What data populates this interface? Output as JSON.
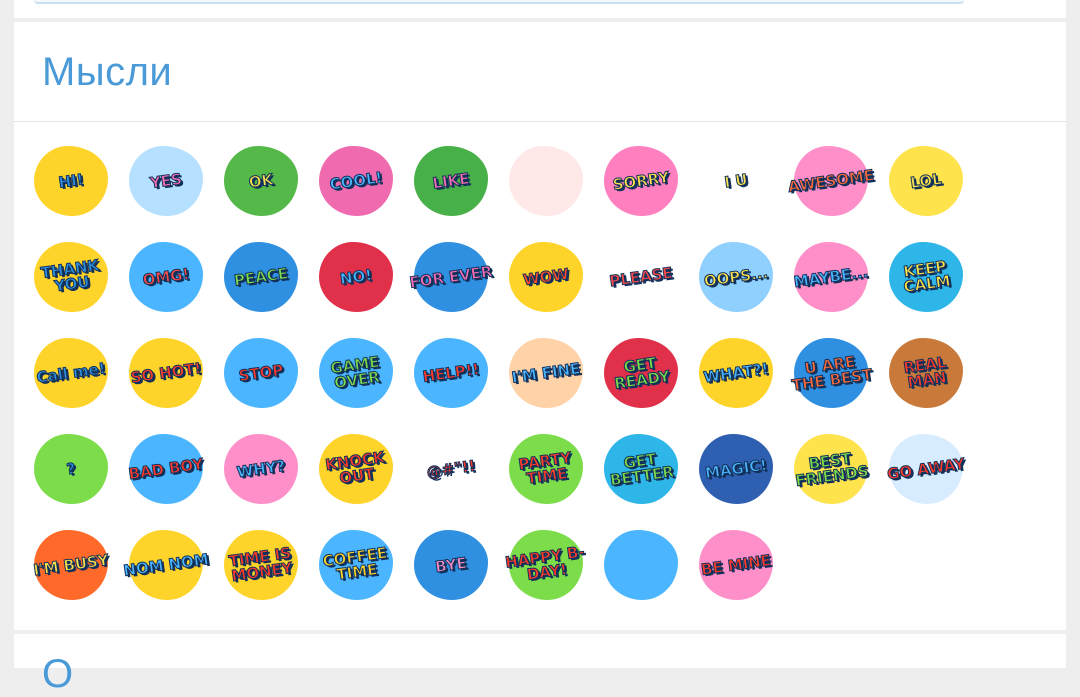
{
  "section": {
    "title": "Мысли",
    "next_title": "О"
  },
  "stickers": [
    {
      "text": "HI!",
      "bg": "#ffd42a",
      "fg": "#2f8fe0"
    },
    {
      "text": "YES",
      "bg": "#b6e0ff",
      "fg": "#ff6fb6"
    },
    {
      "text": "OK",
      "bg": "#54b948",
      "fg": "#ffe34d"
    },
    {
      "text": "COOL!",
      "bg": "#f06ab0",
      "fg": "#4bb6ff"
    },
    {
      "text": "LIKE",
      "bg": "#48b048",
      "fg": "#ff6fb6"
    },
    {
      "text": "",
      "bg": "#ffe8e8",
      "fg": "#e02b3a"
    },
    {
      "text": "SORRY",
      "bg": "#ff7fbf",
      "fg": "#ffe34d"
    },
    {
      "text": "I U",
      "bg": "#ffffff",
      "fg": "#ffe34d"
    },
    {
      "text": "AWESOME",
      "bg": "#ff8fc8",
      "fg": "#ff6a3a"
    },
    {
      "text": "LOL",
      "bg": "#ffe34d",
      "fg": "#ffe34d"
    },
    {
      "text": "THANK YOU",
      "bg": "#ffd42a",
      "fg": "#2f8fe0"
    },
    {
      "text": "OMG!",
      "bg": "#4bb6ff",
      "fg": "#ff4a4a"
    },
    {
      "text": "PEACE",
      "bg": "#2f8fe0",
      "fg": "#7ddc4a"
    },
    {
      "text": "NO!",
      "bg": "#e0304a",
      "fg": "#4bb6ff"
    },
    {
      "text": "FOR EVER",
      "bg": "#2f8fe0",
      "fg": "#ff6fb6"
    },
    {
      "text": "WOW",
      "bg": "#ffd42a",
      "fg": "#ff4a2a"
    },
    {
      "text": "PLEASE",
      "bg": "#ffffff",
      "fg": "#ff4a4a"
    },
    {
      "text": "OOPS...",
      "bg": "#8fd0ff",
      "fg": "#ffe34d"
    },
    {
      "text": "MAYBE...",
      "bg": "#ff8fc8",
      "fg": "#4bb6ff"
    },
    {
      "text": "KEEP CALM",
      "bg": "#2fb6e8",
      "fg": "#ffe34d"
    },
    {
      "text": "Call me!",
      "bg": "#ffd42a",
      "fg": "#2f8fe0"
    },
    {
      "text": "SO HOT!",
      "bg": "#ffd42a",
      "fg": "#ff3a2a"
    },
    {
      "text": "STOP",
      "bg": "#4bb6ff",
      "fg": "#ff3a2a"
    },
    {
      "text": "GAME OVER",
      "bg": "#4bb6ff",
      "fg": "#7ddc4a"
    },
    {
      "text": "HELP!!",
      "bg": "#4bb6ff",
      "fg": "#ff3a2a"
    },
    {
      "text": "I'M FINE",
      "bg": "#ffd2a8",
      "fg": "#4bb6ff"
    },
    {
      "text": "GET READY",
      "bg": "#e0304a",
      "fg": "#7ddc4a"
    },
    {
      "text": "WHAT?!",
      "bg": "#ffd42a",
      "fg": "#4bb6ff"
    },
    {
      "text": "U ARE THE BEST",
      "bg": "#2f8fe0",
      "fg": "#ff6a3a"
    },
    {
      "text": "REAL MAN",
      "bg": "#c97a3a",
      "fg": "#ff3a2a"
    },
    {
      "text": "?",
      "bg": "#7ddc4a",
      "fg": "#2f8fe0"
    },
    {
      "text": "BAD BOY",
      "bg": "#4bb6ff",
      "fg": "#ff3a2a"
    },
    {
      "text": "WHY?",
      "bg": "#ff8fc8",
      "fg": "#4bb6ff"
    },
    {
      "text": "KNOCK OUT",
      "bg": "#ffd42a",
      "fg": "#ff3a2a"
    },
    {
      "text": "@#\"!!",
      "bg": "#ffffff",
      "fg": "#ff3a2a"
    },
    {
      "text": "PARTY TIME",
      "bg": "#7ddc4a",
      "fg": "#ff3a2a"
    },
    {
      "text": "GET BETTER",
      "bg": "#2fb6e8",
      "fg": "#7ddc4a"
    },
    {
      "text": "MAGIC!",
      "bg": "#2f5fb0",
      "fg": "#4bb6ff"
    },
    {
      "text": "BEST FRIENDS",
      "bg": "#ffe34d",
      "fg": "#7ddc4a"
    },
    {
      "text": "GO AWAY",
      "bg": "#d8ecff",
      "fg": "#ff3a2a"
    },
    {
      "text": "I'M BUSY",
      "bg": "#ff6a2a",
      "fg": "#ffe34d"
    },
    {
      "text": "NOM NOM",
      "bg": "#ffd42a",
      "fg": "#4bb6ff"
    },
    {
      "text": "TIME IS MONEY",
      "bg": "#ffd42a",
      "fg": "#ff3a2a"
    },
    {
      "text": "COFFEE TIME",
      "bg": "#4bb6ff",
      "fg": "#ffd42a"
    },
    {
      "text": "BYE",
      "bg": "#2f8fe0",
      "fg": "#ff8fc8"
    },
    {
      "text": "HAPPY B-DAY!",
      "bg": "#7ddc4a",
      "fg": "#ff3a2a"
    },
    {
      "text": "",
      "bg": "#4bb6ff",
      "fg": "#e02b3a"
    },
    {
      "text": "BE MINE",
      "bg": "#ff8fc8",
      "fg": "#ff3a2a"
    }
  ]
}
